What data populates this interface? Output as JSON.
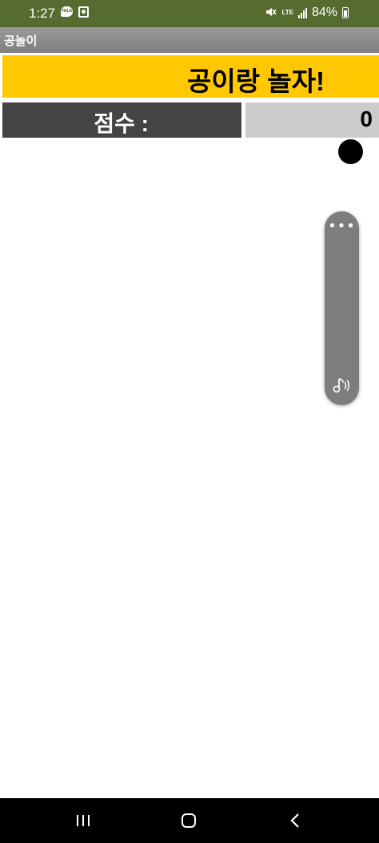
{
  "status_bar": {
    "time": "1:27",
    "notification_icons": [
      "kakaotalk-icon",
      "app-notification-icon"
    ],
    "mute_icon": "mute-icon",
    "network": "LTE",
    "battery": "84%",
    "background": "#556b2f"
  },
  "app": {
    "title": "공놀이"
  },
  "banner": {
    "text": "공이랑 놀자!",
    "color": "#ffc800"
  },
  "score": {
    "label": "점수 :",
    "value": "0",
    "label_bg": "#444444",
    "value_bg": "#cccccc"
  },
  "side_panel": {
    "top_icon": "more-dots-icon",
    "bottom_icon": "sound-icon"
  },
  "nav_bar": {
    "buttons": [
      "recent-apps",
      "home",
      "back"
    ]
  }
}
